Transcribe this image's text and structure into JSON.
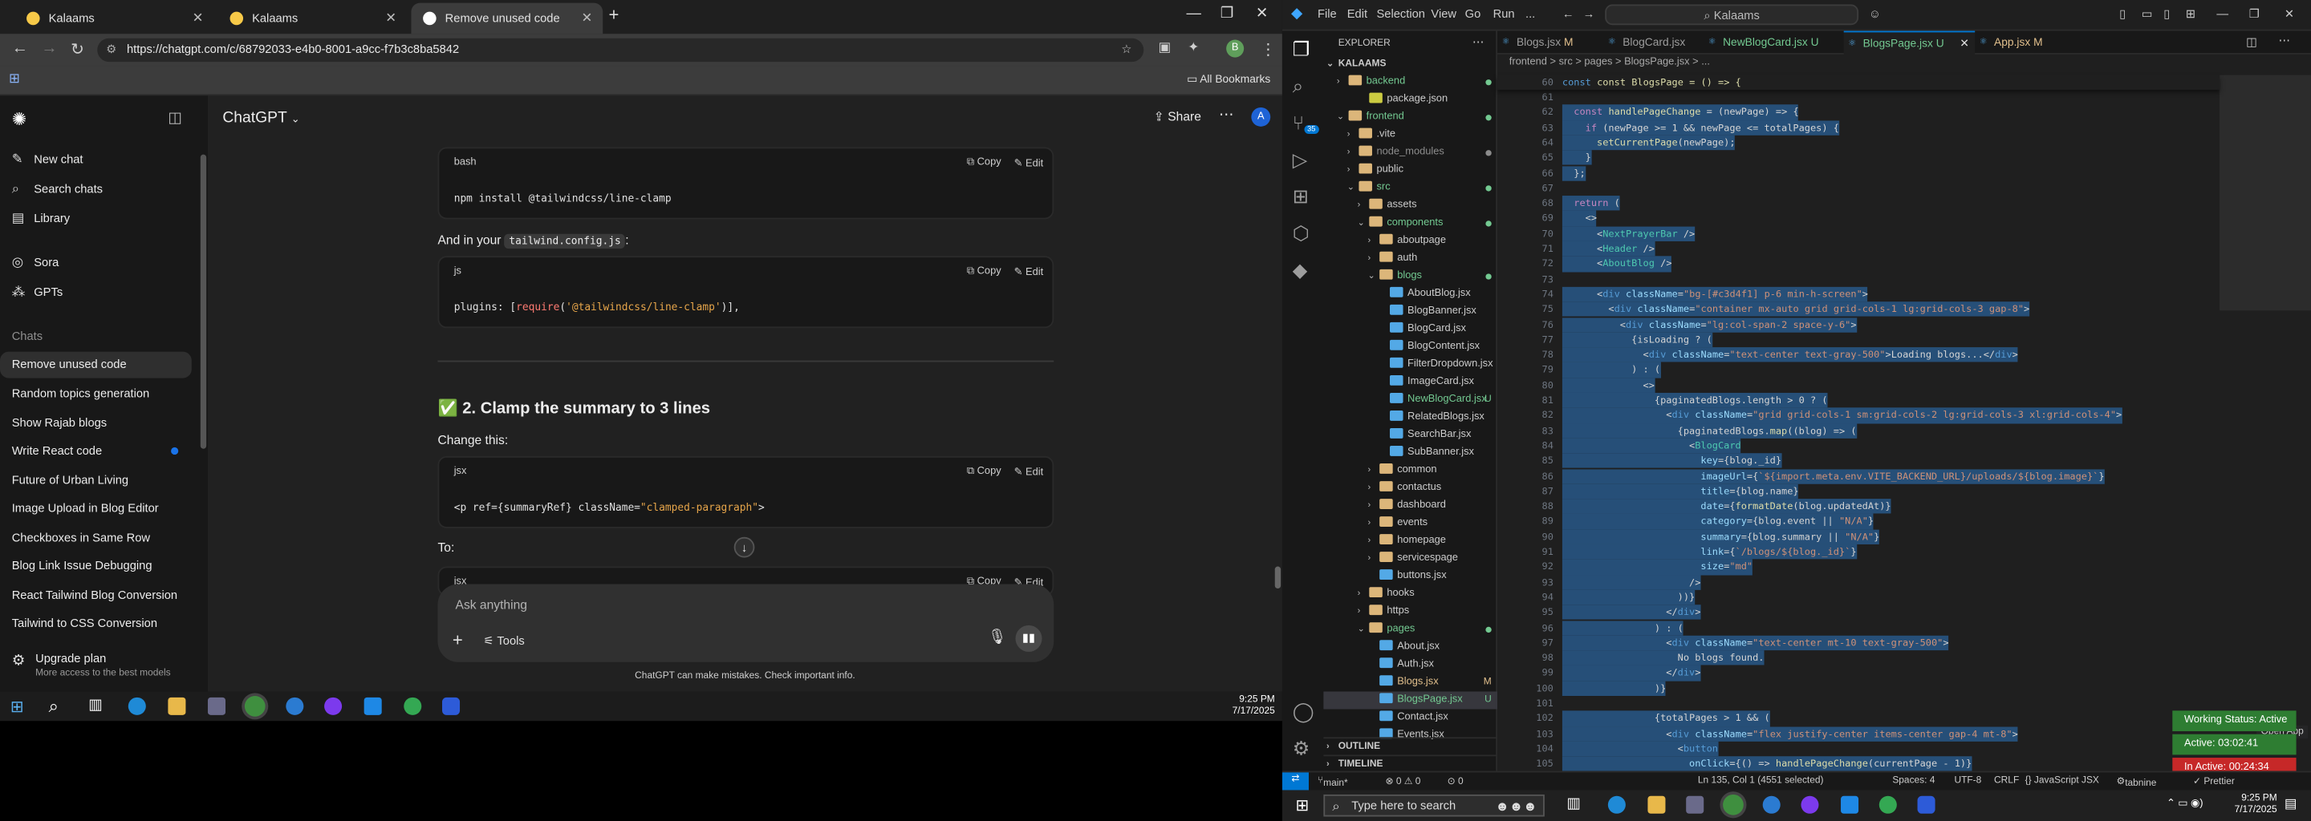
{
  "browser": {
    "tabs": [
      {
        "label": "Kalaams",
        "active": false
      },
      {
        "label": "Kalaams",
        "active": false
      },
      {
        "label": "Remove unused code",
        "active": true
      }
    ],
    "url": "https://chatgpt.com/c/68792033-e4b0-8001-a9cc-f7b3c8ba5842",
    "bookmarks_label": "All Bookmarks"
  },
  "chatgpt": {
    "model": "ChatGPT",
    "share_label": "Share",
    "avatar": "A",
    "sidebar_top": [
      {
        "label": "New chat",
        "icon": "edit-icon"
      },
      {
        "label": "Search chats",
        "icon": "search-icon"
      },
      {
        "label": "Library",
        "icon": "library-icon"
      },
      {
        "label": "Sora",
        "icon": "sora-icon"
      },
      {
        "label": "GPTs",
        "icon": "gpts-icon"
      }
    ],
    "chats_heading": "Chats",
    "chats": [
      "Remove unused code",
      "Random topics generation",
      "Show Rajab blogs",
      "Write React code",
      "Future of Urban Living",
      "Image Upload in Blog Editor",
      "Checkboxes in Same Row",
      "Blog Link Issue Debugging",
      "React Tailwind Blog Conversion",
      "Tailwind to CSS Conversion"
    ],
    "upgrade_title": "Upgrade plan",
    "upgrade_sub": "More access to the best models",
    "blocks": {
      "b1_lang": "bash",
      "b1_code": "npm install @tailwindcss/line-clamp",
      "and_in_your": "And in your",
      "config_file": "tailwind.config.js",
      "b2_lang": "js",
      "b2_code_a": "plugins: [",
      "b2_code_b": "require",
      "b2_code_c": "(",
      "b2_code_d": "'@tailwindcss/line-clamp'",
      "b2_code_e": ")],",
      "heading": "✅ 2. Clamp the summary to 3 lines",
      "change_this": "Change this:",
      "b3_lang": "jsx",
      "b3_code_a": "<p ref={summaryRef} className=",
      "b3_code_b": "\"clamped-paragraph\"",
      "b3_code_c": ">",
      "to_label": "To:",
      "b4_lang": "jsx",
      "copy": "Copy",
      "edit": "Edit"
    },
    "composer_placeholder": "Ask anything",
    "tools_label": "Tools",
    "disclaimer": "ChatGPT can make mistakes. Check important info."
  },
  "vscode": {
    "menus": [
      "File",
      "Edit",
      "Selection",
      "View",
      "Go",
      "Run",
      "..."
    ],
    "search": "Kalaams",
    "explorer_title": "EXPLORER",
    "root": "KALAAMS",
    "tree": [
      {
        "label": "backend",
        "indent": 1,
        "type": "folder",
        "open": false,
        "badge": "",
        "color": "#73c991"
      },
      {
        "label": "package.json",
        "indent": 3,
        "type": "json",
        "badge": ""
      },
      {
        "label": "frontend",
        "indent": 1,
        "type": "folder",
        "open": true,
        "badge": "",
        "color": "#73c991"
      },
      {
        "label": ".vite",
        "indent": 2,
        "type": "folder",
        "open": false,
        "badge": ""
      },
      {
        "label": "node_modules",
        "indent": 2,
        "type": "folder",
        "open": false,
        "badge": "",
        "color": "#8c8c8c"
      },
      {
        "label": "public",
        "indent": 2,
        "type": "folder",
        "open": false,
        "badge": ""
      },
      {
        "label": "src",
        "indent": 2,
        "type": "folder",
        "open": true,
        "badge": "",
        "color": "#73c991"
      },
      {
        "label": "assets",
        "indent": 3,
        "type": "folder",
        "open": false,
        "badge": ""
      },
      {
        "label": "components",
        "indent": 3,
        "type": "folder",
        "open": true,
        "badge": "",
        "color": "#73c991"
      },
      {
        "label": "aboutpage",
        "indent": 4,
        "type": "folder",
        "open": false,
        "badge": ""
      },
      {
        "label": "auth",
        "indent": 4,
        "type": "folder",
        "open": false,
        "badge": ""
      },
      {
        "label": "blogs",
        "indent": 4,
        "type": "folder",
        "open": true,
        "badge": "",
        "color": "#73c991"
      },
      {
        "label": "AboutBlog.jsx",
        "indent": 5,
        "type": "jsx",
        "badge": ""
      },
      {
        "label": "BlogBanner.jsx",
        "indent": 5,
        "type": "jsx",
        "badge": ""
      },
      {
        "label": "BlogCard.jsx",
        "indent": 5,
        "type": "jsx",
        "badge": ""
      },
      {
        "label": "BlogContent.jsx",
        "indent": 5,
        "type": "jsx",
        "badge": ""
      },
      {
        "label": "FilterDropdown.jsx",
        "indent": 5,
        "type": "jsx",
        "badge": ""
      },
      {
        "label": "ImageCard.jsx",
        "indent": 5,
        "type": "jsx",
        "badge": ""
      },
      {
        "label": "NewBlogCard.jsx",
        "indent": 5,
        "type": "jsx",
        "badge": "U",
        "color": "#73c991"
      },
      {
        "label": "RelatedBlogs.jsx",
        "indent": 5,
        "type": "jsx",
        "badge": ""
      },
      {
        "label": "SearchBar.jsx",
        "indent": 5,
        "type": "jsx",
        "badge": ""
      },
      {
        "label": "SubBanner.jsx",
        "indent": 5,
        "type": "jsx",
        "badge": ""
      },
      {
        "label": "common",
        "indent": 4,
        "type": "folder",
        "open": false,
        "badge": ""
      },
      {
        "label": "contactus",
        "indent": 4,
        "type": "folder",
        "open": false,
        "badge": ""
      },
      {
        "label": "dashboard",
        "indent": 4,
        "type": "folder",
        "open": false,
        "badge": ""
      },
      {
        "label": "events",
        "indent": 4,
        "type": "folder",
        "open": false,
        "badge": ""
      },
      {
        "label": "homepage",
        "indent": 4,
        "type": "folder",
        "open": false,
        "badge": ""
      },
      {
        "label": "servicespage",
        "indent": 4,
        "type": "folder",
        "open": false,
        "badge": ""
      },
      {
        "label": "buttons.jsx",
        "indent": 4,
        "type": "jsx",
        "badge": ""
      },
      {
        "label": "hooks",
        "indent": 3,
        "type": "folder",
        "open": false,
        "badge": ""
      },
      {
        "label": "https",
        "indent": 3,
        "type": "folder",
        "open": false,
        "badge": ""
      },
      {
        "label": "pages",
        "indent": 3,
        "type": "folder",
        "open": true,
        "badge": "",
        "color": "#73c991"
      },
      {
        "label": "About.jsx",
        "indent": 4,
        "type": "jsx",
        "badge": ""
      },
      {
        "label": "Auth.jsx",
        "indent": 4,
        "type": "jsx",
        "badge": ""
      },
      {
        "label": "Blogs.jsx",
        "indent": 4,
        "type": "jsx",
        "badge": "M",
        "color": "#e2c08d"
      },
      {
        "label": "BlogsPage.jsx",
        "indent": 4,
        "type": "jsx",
        "badge": "U",
        "color": "#73c991",
        "selected": true
      },
      {
        "label": "Contact.jsx",
        "indent": 4,
        "type": "jsx",
        "badge": ""
      },
      {
        "label": "Events.jsx",
        "indent": 4,
        "type": "jsx",
        "badge": ""
      }
    ],
    "outline": "OUTLINE",
    "timeline": "TIMELINE",
    "tabs": [
      {
        "label": "Blogs.jsx",
        "badge": "M"
      },
      {
        "label": "BlogCard.jsx",
        "badge": ""
      },
      {
        "label": "NewBlogCard.jsx",
        "badge": "U"
      },
      {
        "label": "BlogsPage.jsx",
        "badge": "U",
        "active": true
      },
      {
        "label": "App.jsx",
        "badge": "M"
      }
    ],
    "breadcrumb": "frontend > src > pages > BlogsPage.jsx > ...",
    "sticky_line": "const BlogsPage = () => {",
    "code": [
      {
        "n": "61",
        "t": ""
      },
      {
        "n": "62",
        "t": "  const handlePageChange = (newPage) => {"
      },
      {
        "n": "63",
        "t": "    if (newPage >= 1 && newPage <= totalPages) {"
      },
      {
        "n": "64",
        "t": "      setCurrentPage(newPage);"
      },
      {
        "n": "65",
        "t": "    }"
      },
      {
        "n": "66",
        "t": "  };"
      },
      {
        "n": "67",
        "t": ""
      },
      {
        "n": "68",
        "t": "  return ("
      },
      {
        "n": "69",
        "t": "    <>"
      },
      {
        "n": "70",
        "t": "      <NextPrayerBar />"
      },
      {
        "n": "71",
        "t": "      <Header />"
      },
      {
        "n": "72",
        "t": "      <AboutBlog />"
      },
      {
        "n": "73",
        "t": ""
      },
      {
        "n": "74",
        "t": "      <div className=\"bg-[#c3d4f1] p-6 min-h-screen\">"
      },
      {
        "n": "75",
        "t": "        <div className=\"container mx-auto grid grid-cols-1 lg:grid-cols-3 gap-8\">"
      },
      {
        "n": "76",
        "t": "          <div className=\"lg:col-span-2 space-y-6\">"
      },
      {
        "n": "77",
        "t": "            {isLoading ? ("
      },
      {
        "n": "78",
        "t": "              <div className=\"text-center text-gray-500\">Loading blogs...</div>"
      },
      {
        "n": "79",
        "t": "            ) : ("
      },
      {
        "n": "80",
        "t": "              <>"
      },
      {
        "n": "81",
        "t": "                {paginatedBlogs.length > 0 ? ("
      },
      {
        "n": "82",
        "t": "                  <div className=\"grid grid-cols-1 sm:grid-cols-2 lg:grid-cols-3 xl:grid-cols-4\">"
      },
      {
        "n": "83",
        "t": "                    {paginatedBlogs.map((blog) => ("
      },
      {
        "n": "84",
        "t": "                      <BlogCard"
      },
      {
        "n": "85",
        "t": "                        key={blog._id}"
      },
      {
        "n": "86",
        "t": "                        imageUrl={`${import.meta.env.VITE_BACKEND_URL}/uploads/${blog.image}`}"
      },
      {
        "n": "87",
        "t": "                        title={blog.name}"
      },
      {
        "n": "88",
        "t": "                        date={formatDate(blog.updatedAt)}"
      },
      {
        "n": "89",
        "t": "                        category={blog.event || \"N/A\"}"
      },
      {
        "n": "90",
        "t": "                        summary={blog.summary || \"N/A\"}"
      },
      {
        "n": "91",
        "t": "                        link={`/blogs/${blog._id}`}"
      },
      {
        "n": "92",
        "t": "                        size=\"md\""
      },
      {
        "n": "93",
        "t": "                      />"
      },
      {
        "n": "94",
        "t": "                    ))}"
      },
      {
        "n": "95",
        "t": "                  </div>"
      },
      {
        "n": "96",
        "t": "                ) : ("
      },
      {
        "n": "97",
        "t": "                  <div className=\"text-center mt-10 text-gray-500\">"
      },
      {
        "n": "98",
        "t": "                    No blogs found."
      },
      {
        "n": "99",
        "t": "                  </div>"
      },
      {
        "n": "100",
        "t": "                )}"
      },
      {
        "n": "101",
        "t": ""
      },
      {
        "n": "102",
        "t": "                {totalPages > 1 && ("
      },
      {
        "n": "103",
        "t": "                  <div className=\"flex justify-center items-center gap-4 mt-8\">"
      },
      {
        "n": "104",
        "t": "                    <button"
      },
      {
        "n": "105",
        "t": "                      onClick={() => handlePageChange(currentPage - 1)}"
      }
    ],
    "open_app": "Open App",
    "status_pills": [
      {
        "label": "Working Status: Active",
        "color": "#2e7d32"
      },
      {
        "label": "Active: 03:02:41",
        "color": "#2e7d32"
      },
      {
        "label": "In Active: 00:24:34",
        "color": "#c62828"
      }
    ],
    "status": {
      "branch": "main*",
      "errors": "⊗ 0 ⚠ 0",
      "counts": "⊙ 0",
      "position": "Ln 135, Col 1 (4551 selected)",
      "spaces": "Spaces: 4",
      "encoding": "UTF-8",
      "eol": "CRLF",
      "language": "{} JavaScript JSX",
      "tabnine": "tabnine",
      "prettier": "✓ Prettier"
    }
  },
  "taskbar": {
    "left_time": "9:25 PM",
    "left_date": "7/17/2025",
    "right_time": "9:25 PM",
    "right_date": "7/17/2025",
    "search_placeholder": "Type here to search"
  }
}
